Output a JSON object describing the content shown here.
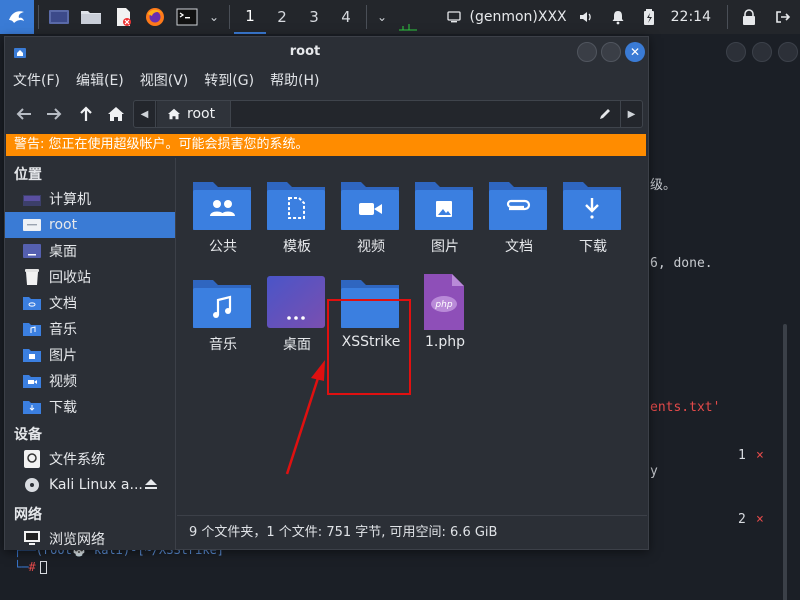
{
  "panel": {
    "workspaces": [
      "1",
      "2",
      "3",
      "4"
    ],
    "active_workspace": "1",
    "genmon_text": "(genmon)XXX",
    "clock": "22:14",
    "accent": "#3a7bd5"
  },
  "terminal": {
    "fragments": {
      "line1": "级。",
      "line2": "6, done.",
      "line3": "ents.txt'",
      "line4": "y",
      "prompt": "(root💀 kali)-[~/XSStrike]",
      "prompt_hash": "#"
    },
    "markers": [
      {
        "num": "1",
        "mark": "×"
      },
      {
        "num": "2",
        "mark": "×"
      }
    ]
  },
  "window": {
    "title": "root",
    "close_glyph": "✕"
  },
  "menubar": [
    "文件(F)",
    "编辑(E)",
    "视图(V)",
    "转到(G)",
    "帮助(H)"
  ],
  "toolbar": {
    "path_current": "root"
  },
  "warning": "警告: 您正在使用超级帐户。可能会损害您的系统。",
  "sidebar": {
    "places_header": "位置",
    "places": [
      {
        "label": "计算机",
        "icon": "computer-icon"
      },
      {
        "label": "root",
        "icon": "home-folder-icon",
        "selected": true
      },
      {
        "label": "桌面",
        "icon": "desktop-icon"
      },
      {
        "label": "回收站",
        "icon": "trash-icon"
      },
      {
        "label": "文档",
        "icon": "documents-folder-icon"
      },
      {
        "label": "音乐",
        "icon": "music-folder-icon"
      },
      {
        "label": "图片",
        "icon": "pictures-folder-icon"
      },
      {
        "label": "视频",
        "icon": "videos-folder-icon"
      },
      {
        "label": "下载",
        "icon": "downloads-folder-icon"
      }
    ],
    "devices_header": "设备",
    "devices": [
      {
        "label": "文件系统",
        "icon": "drive-icon"
      },
      {
        "label": "Kali Linux a...",
        "icon": "disc-icon"
      }
    ],
    "network_header": "网络",
    "network": [
      {
        "label": "浏览网络",
        "icon": "network-icon"
      }
    ]
  },
  "files": [
    {
      "name": "公共",
      "kind": "folder",
      "emblem": "people"
    },
    {
      "name": "模板",
      "kind": "folder",
      "emblem": "template"
    },
    {
      "name": "视频",
      "kind": "folder",
      "emblem": "video"
    },
    {
      "name": "图片",
      "kind": "folder",
      "emblem": "picture"
    },
    {
      "name": "文档",
      "kind": "folder",
      "emblem": "clip"
    },
    {
      "name": "下载",
      "kind": "folder",
      "emblem": "download"
    },
    {
      "name": "音乐",
      "kind": "folder",
      "emblem": "music"
    },
    {
      "name": "桌面",
      "kind": "desktop",
      "emblem": "dots"
    },
    {
      "name": "XSStrike",
      "kind": "folder",
      "emblem": "none",
      "highlighted": true
    },
    {
      "name": "1.php",
      "kind": "php-file",
      "emblem": "php"
    }
  ],
  "status": "9 个文件夹，1 个文件: 751 字节, 可用空间: 6.6 GiB",
  "colors": {
    "folder": "#3b7fe0",
    "folder_back": "#2f66c0",
    "warning": "#ff8c00",
    "highlight": "#e01010",
    "php": "#8e4fb8"
  }
}
